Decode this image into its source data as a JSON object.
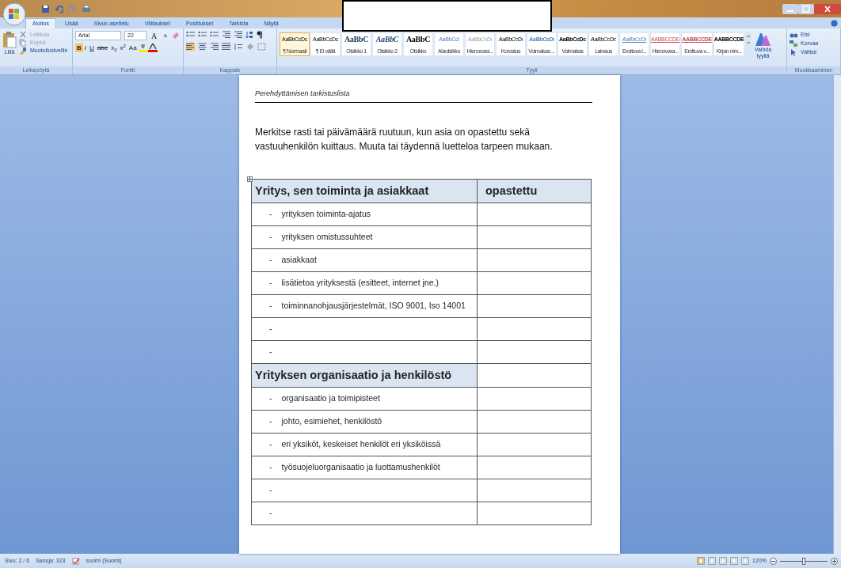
{
  "tabs": [
    {
      "label": "Aloitus",
      "selected": true
    },
    {
      "label": "Lisää",
      "selected": false
    },
    {
      "label": "Sivun asettelu",
      "selected": false
    },
    {
      "label": "Viittaukset",
      "selected": false
    },
    {
      "label": "Postitukset",
      "selected": false
    },
    {
      "label": "Tarkista",
      "selected": false
    },
    {
      "label": "Näytä",
      "selected": false
    }
  ],
  "clipboard": {
    "label": "Leikepöytä",
    "paste": "Liitä",
    "commands": [
      {
        "label": "Leikkaa",
        "kind": "cut",
        "disabled": true
      },
      {
        "label": "Kopioi",
        "kind": "copy",
        "disabled": true
      },
      {
        "label": "Muotoilusivellin",
        "kind": "brush",
        "disabled": false
      }
    ]
  },
  "font": {
    "label": "Fontti",
    "font_name": "Arial",
    "font_size": "22",
    "grow": "A",
    "shrink": "A",
    "format_buttons": [
      {
        "label": "B",
        "kind": "bold"
      },
      {
        "label": "I",
        "kind": "italic"
      },
      {
        "label": "U",
        "kind": "underline"
      },
      {
        "label": "abe",
        "kind": "strike"
      },
      {
        "label": "x$_{2}$",
        "kind": "plain"
      },
      {
        "label": "x$^{2}$",
        "kind": "plain"
      },
      {
        "label": "Aa",
        "kind": "plain"
      }
    ]
  },
  "paragraph": {
    "label": "Kappale"
  },
  "styles": {
    "label": "Tyyli",
    "change_styles": "Vaihda tyyliä",
    "items": [
      {
        "preview": "AaBbCcDc",
        "name": "¶ Normaali",
        "kind": "body",
        "selected": true
      },
      {
        "preview": "AaBbCcDc",
        "name": "¶ Ei väliä",
        "kind": "body",
        "selected": false
      },
      {
        "preview": "AaBbC",
        "name": "Otsikko 1",
        "kind": "heading",
        "selected": false
      },
      {
        "preview": "AaBbC",
        "name": "Otsikko 2",
        "kind": "heading-italic",
        "selected": false
      },
      {
        "preview": "AaBbC",
        "name": "Otsikko",
        "kind": "title",
        "selected": false
      },
      {
        "preview": "AaBbCcI",
        "name": "Alaotsikko",
        "kind": "subtitle",
        "selected": false
      },
      {
        "preview": "AaBbCcDı",
        "name": "Hienovara...",
        "kind": "subtle",
        "selected": false
      },
      {
        "preview": "AaBbCcDı",
        "name": "Korostus",
        "kind": "emphasis",
        "selected": false
      },
      {
        "preview": "AaBbCcDı",
        "name": "Voimakas ...",
        "kind": "intense",
        "selected": false
      },
      {
        "preview": "AaBbCcDc",
        "name": "Voimakas",
        "kind": "strong",
        "selected": false
      },
      {
        "preview": "AaBbCcDc",
        "name": "Lainaus",
        "kind": "quote",
        "selected": false
      },
      {
        "preview": "AaBbCcDı",
        "name": "Erottuva l...",
        "kind": "intense-quote",
        "selected": false
      },
      {
        "preview": "AABBCCDE",
        "name": "Hienovara...",
        "kind": "subtle-ref",
        "selected": false
      },
      {
        "preview": "AABBCCDE",
        "name": "Erottuva v...",
        "kind": "intense-ref",
        "selected": false
      },
      {
        "preview": "AABBCCDE",
        "name": "Kirjan nim...",
        "kind": "book",
        "selected": false
      }
    ]
  },
  "editing": {
    "label": "Muokkaaminen",
    "commands": [
      {
        "label": "Etsi",
        "kind": "find"
      },
      {
        "label": "Korvaa",
        "kind": "replace"
      },
      {
        "label": "Valitse",
        "kind": "select"
      }
    ]
  },
  "document": {
    "header": "Perehdyttämisen tarkistuslista",
    "intro": "Merkitse rasti tai päivämäärä ruutuun, kun asia on opastettu sekä vastuuhenkilön kuittaus. Muuta tai täydennä luetteloa tarpeen mukaan.",
    "table": {
      "rows": [
        {
          "kind": "heading",
          "cells": [
            "Yritys, sen toiminta ja asiakkaat",
            "opastettu"
          ]
        },
        {
          "kind": "item",
          "marker": "-",
          "text": "yrityksen toiminta-ajatus"
        },
        {
          "kind": "item",
          "marker": "-",
          "text": "yrityksen omistussuhteet"
        },
        {
          "kind": "item",
          "marker": "-",
          "text": "asiakkaat"
        },
        {
          "kind": "item",
          "marker": "-",
          "text": "lisätietoa yrityksestä (esitteet, internet jne.)"
        },
        {
          "kind": "item",
          "marker": "-",
          "text": "toiminnanohjausjärjestelmät, ISO 9001, Iso 14001"
        },
        {
          "kind": "item",
          "marker": "-"
        },
        {
          "kind": "item",
          "marker": "-"
        },
        {
          "kind": "heading",
          "cells": [
            "Yrityksen organisaatio ja henkilöstö"
          ]
        },
        {
          "kind": "item",
          "marker": "-",
          "text": "organisaatio ja toimipisteet"
        },
        {
          "kind": "item",
          "marker": "-",
          "text": "johto, esimiehet, henkilöstö"
        },
        {
          "kind": "item",
          "marker": "-",
          "text": "eri yksiköt, keskeiset henkilöt eri yksiköissä"
        },
        {
          "kind": "item",
          "marker": "-",
          "text": "työsuojeluorganisaatio ja luottamushenkilöt"
        },
        {
          "kind": "item",
          "marker": "-"
        },
        {
          "kind": "item",
          "marker": "-"
        }
      ]
    }
  },
  "status_bar": {
    "page": "Sivu: 2 / 6",
    "words": "Sanoja: 323",
    "language": "suomi (Suomi)",
    "zoom": "120%",
    "zoom_slider": {
      "level": 0.5
    }
  }
}
